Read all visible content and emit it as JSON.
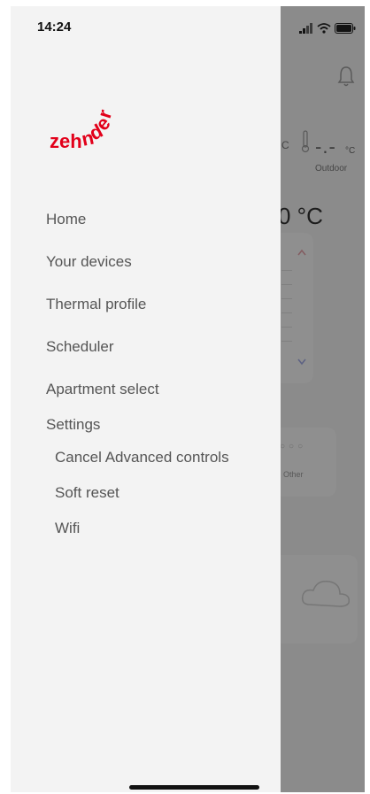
{
  "status_bar": {
    "time": "14:24",
    "icons": [
      "signal-icon",
      "wifi-icon",
      "battery-icon"
    ]
  },
  "brand": {
    "logo_text": "zehnder",
    "color": "#e2001a"
  },
  "menu": {
    "items": [
      {
        "label": "Home"
      },
      {
        "label": "Your devices"
      },
      {
        "label": "Thermal profile"
      },
      {
        "label": "Scheduler"
      },
      {
        "label": "Apartment select"
      },
      {
        "label": "Settings"
      }
    ],
    "settings_sub": [
      {
        "label": "Cancel Advanced controls"
      },
      {
        "label": "Soft reset"
      },
      {
        "label": "Wifi"
      }
    ]
  },
  "background": {
    "indoor_unit": "C",
    "outdoor_value": "-.-",
    "outdoor_unit": "°C",
    "outdoor_label": "Outdoor",
    "main_temp": "0 °C",
    "card_label": "Other",
    "card_dots": "○○○"
  }
}
